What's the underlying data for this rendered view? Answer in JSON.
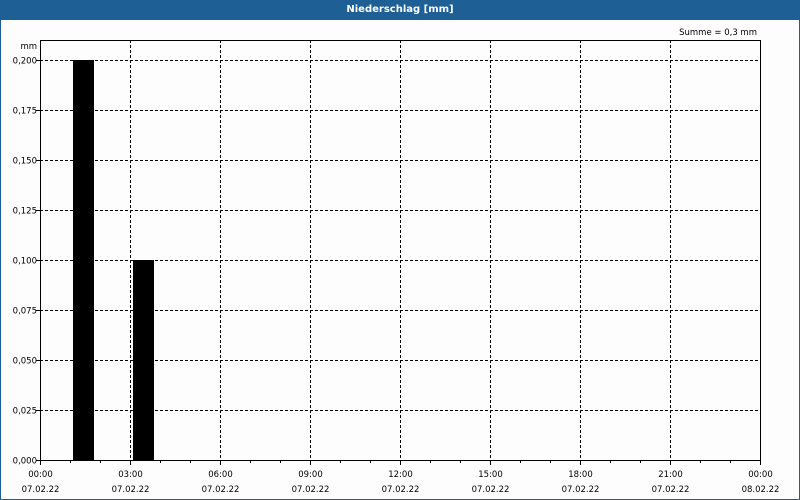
{
  "chart_data": {
    "type": "bar",
    "title": "Niederschlag [mm]",
    "ylabel": "mm",
    "annotation": "Summe = 0,3 mm",
    "ylim": [
      0,
      0.2
    ],
    "yticks": [
      "0,000",
      "0,025",
      "0,050",
      "0,075",
      "0,100",
      "0,125",
      "0,150",
      "0,175",
      "0,200"
    ],
    "xlim_hours": [
      0,
      24
    ],
    "xticks": [
      {
        "time": "00:00",
        "date": "07.02.22"
      },
      {
        "time": "03:00",
        "date": "07.02.22"
      },
      {
        "time": "06:00",
        "date": "07.02.22"
      },
      {
        "time": "09:00",
        "date": "07.02.22"
      },
      {
        "time": "12:00",
        "date": "07.02.22"
      },
      {
        "time": "15:00",
        "date": "07.02.22"
      },
      {
        "time": "18:00",
        "date": "07.02.22"
      },
      {
        "time": "21:00",
        "date": "07.02.22"
      },
      {
        "time": "00:00",
        "date": "08.02.22"
      }
    ],
    "bars": [
      {
        "hour_start": 1,
        "value": 0.2
      },
      {
        "hour_start": 3,
        "value": 0.1
      }
    ],
    "grid": true,
    "colors": {
      "bar": "#000000",
      "title_bg": "#1e6096"
    }
  }
}
